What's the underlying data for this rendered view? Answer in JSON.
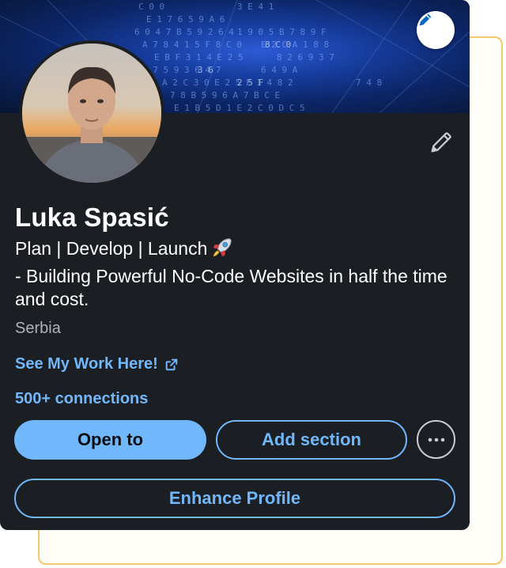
{
  "profile": {
    "name": "Luka Spasić",
    "headline_line1": "Plan | Develop | Launch",
    "headline_line2": "- Building Powerful No-Code Websites in half the time and cost.",
    "location": "Serbia",
    "website_link": "See My Work Here!",
    "connections": "500+ connections"
  },
  "actions": {
    "open_to": "Open to",
    "add_section": "Add section",
    "enhance_profile": "Enhance Profile"
  },
  "icons": {
    "cover_edit": "pencil-icon",
    "intro_edit": "pencil-icon",
    "external_link": "external-link-icon",
    "more": "ellipsis-icon",
    "headline_emoji": "rocket-icon"
  },
  "colors": {
    "card_background": "#1b1f23",
    "accent": "#71b7fb",
    "text_primary": "#ffffff",
    "text_secondary": "#b0b3b7",
    "backdrop_border": "#f2c96a",
    "cover_blue": "#163d9e"
  }
}
